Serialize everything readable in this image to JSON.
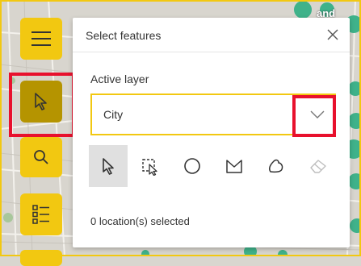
{
  "map": {
    "visible_label": "and"
  },
  "toolbar": {
    "menu_icon": "hamburger-icon",
    "select_icon": "cursor-arrow-icon",
    "search_icon": "search-icon",
    "legend_icon": "list-icon"
  },
  "panel": {
    "title": "Select features",
    "close_icon": "close-icon",
    "active_layer_label": "Active layer",
    "active_layer_value": "City",
    "status": "0 location(s) selected",
    "tools": [
      "pointer-select-icon",
      "rectangle-select-icon",
      "circle-select-icon",
      "lasso-select-icon",
      "freehand-select-icon",
      "eraser-icon"
    ]
  },
  "colors": {
    "accent": "#f2c811",
    "accent_dark": "#b59400",
    "highlight": "#e8112d"
  }
}
